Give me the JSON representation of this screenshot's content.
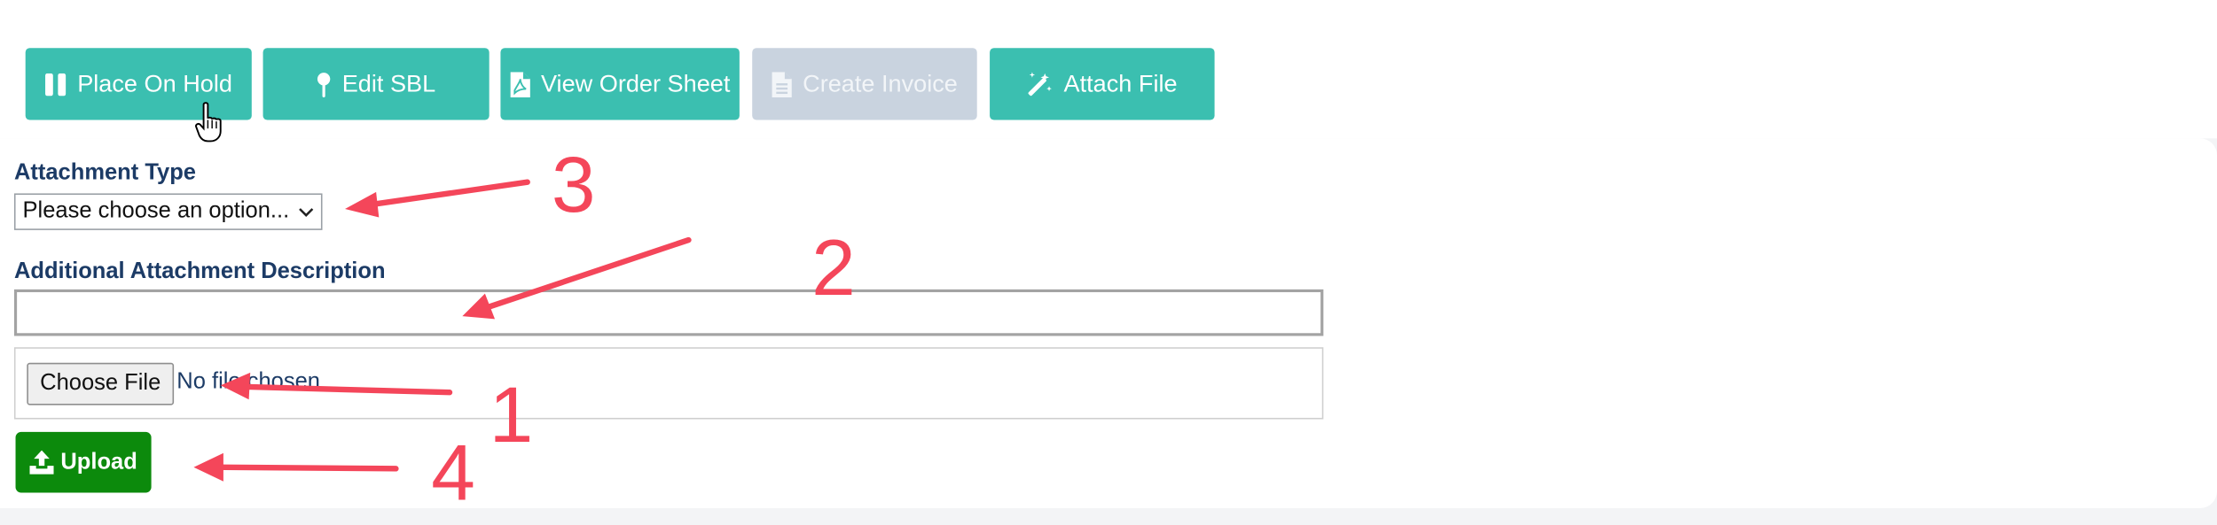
{
  "toolbar": {
    "buttons": [
      {
        "label": "Place On Hold",
        "icon": "pause-icon",
        "enabled": true
      },
      {
        "label": "Edit SBL",
        "icon": "map-pin-icon",
        "enabled": true
      },
      {
        "label": "View Order Sheet",
        "icon": "pdf-file-icon",
        "enabled": true
      },
      {
        "label": "Create Invoice",
        "icon": "document-icon",
        "enabled": false
      },
      {
        "label": "Attach File",
        "icon": "magic-wand-icon",
        "enabled": true
      }
    ]
  },
  "form": {
    "attachment_type_label": "Attachment Type",
    "attachment_type_value": "Please choose an option...",
    "description_label": "Additional Attachment Description",
    "description_value": "",
    "choose_file_label": "Choose File",
    "no_file_text": "No file chosen",
    "upload_label": "Upload"
  },
  "annotations": {
    "step_1": "1",
    "step_2": "2",
    "step_3": "3",
    "step_4": "4"
  },
  "colors": {
    "button_teal": "#3bbfb0",
    "button_disabled": "#c9d3df",
    "upload_green": "#0c8a0c",
    "label_navy": "#1c3b66",
    "annotation_red": "#f4465a"
  }
}
